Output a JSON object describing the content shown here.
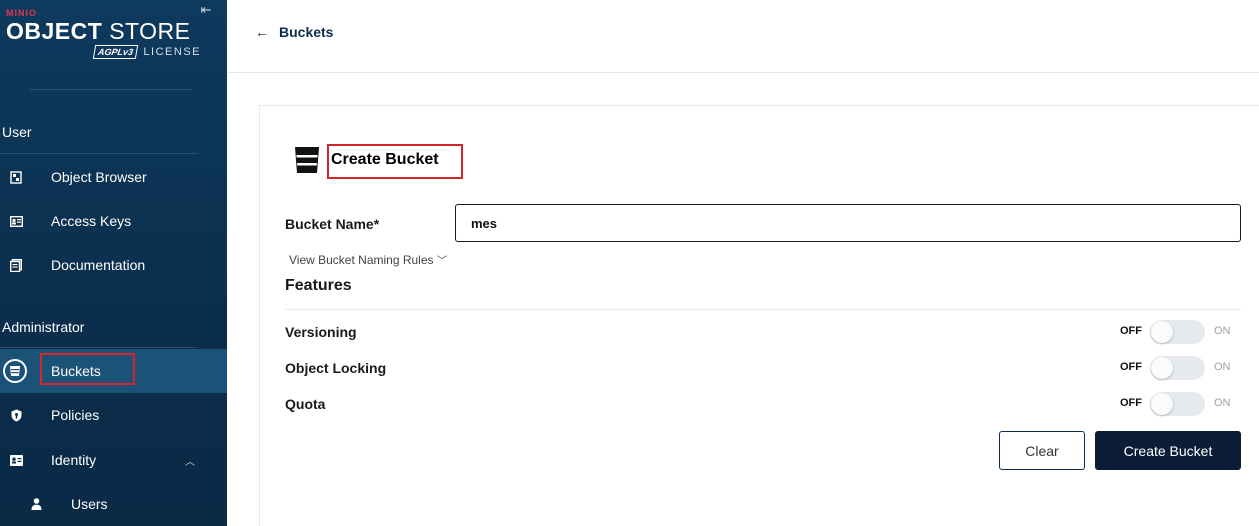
{
  "app": {
    "brand": "MINIO",
    "product_bold": "OBJECT",
    "product_light": "STORE",
    "license_badge": "AGPLv3",
    "license_label": "LICENSE",
    "collapse_icon": "collapse-sidebar-icon"
  },
  "sidebar": {
    "sections": [
      {
        "label": "User",
        "items": [
          {
            "label": "Object Browser",
            "icon": "object-browser-icon"
          },
          {
            "label": "Access Keys",
            "icon": "access-keys-icon"
          },
          {
            "label": "Documentation",
            "icon": "documentation-icon"
          }
        ]
      },
      {
        "label": "Administrator",
        "items": [
          {
            "label": "Buckets",
            "icon": "bucket-icon",
            "active": true
          },
          {
            "label": "Policies",
            "icon": "policies-icon"
          },
          {
            "label": "Identity",
            "icon": "identity-icon",
            "expanded": true
          },
          {
            "label": "Users",
            "icon": "user-icon"
          }
        ]
      }
    ]
  },
  "header": {
    "back_label": "Buckets"
  },
  "form": {
    "title": "Create Bucket",
    "bucket_name_label": "Bucket Name*",
    "bucket_name_value": "mes",
    "naming_rules_link": "View Bucket Naming Rules",
    "features_title": "Features",
    "features": [
      {
        "label": "Versioning",
        "off_label": "OFF",
        "on_label": "ON",
        "enabled": false
      },
      {
        "label": "Object Locking",
        "off_label": "OFF",
        "on_label": "ON",
        "enabled": false
      },
      {
        "label": "Quota",
        "off_label": "OFF",
        "on_label": "ON",
        "enabled": false
      }
    ],
    "clear_button": "Clear",
    "create_button": "Create Bucket"
  },
  "colors": {
    "sidebar_bg": "#0b2e4c",
    "sidebar_active": "#1b5278",
    "primary_button": "#0c1d38",
    "highlight": "#d7262b",
    "brand_red": "#e3344d"
  }
}
